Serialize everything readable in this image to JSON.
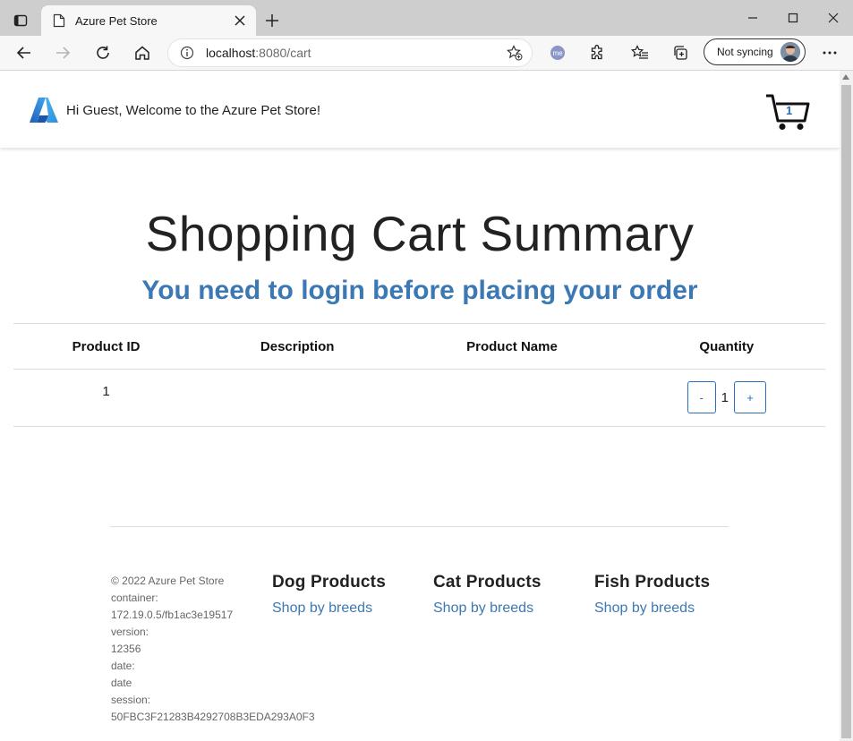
{
  "browser": {
    "tab_title": "Azure Pet Store",
    "url_host": "localhost",
    "url_path": ":8080/cart",
    "profile_label": "Not syncing",
    "extension_label": "me"
  },
  "header": {
    "welcome": "Hi Guest, Welcome to the Azure Pet Store!",
    "cart_count": "1"
  },
  "main": {
    "title": "Shopping Cart Summary",
    "login_message": "You need to login before placing your order",
    "table": {
      "columns": [
        "Product ID",
        "Description",
        "Product Name",
        "Quantity"
      ],
      "rows": [
        {
          "product_id": "1",
          "description": "",
          "product_name": "",
          "quantity": "1",
          "minus": "-",
          "plus": "+"
        }
      ]
    }
  },
  "footer": {
    "copyright": "© 2022 Azure Pet Store",
    "container_label": "container:",
    "container_value": "172.19.0.5/fb1ac3e19517",
    "version_label": "version:",
    "version_value": "12356",
    "date_label": "date:",
    "date_value": "date",
    "session_label": "session:",
    "session_value": "50FBC3F21283B4292708B3EDA293A0F3",
    "columns": [
      {
        "heading": "Dog Products",
        "link": "Shop by breeds"
      },
      {
        "heading": "Cat Products",
        "link": "Shop by breeds"
      },
      {
        "heading": "Fish Products",
        "link": "Shop by breeds"
      }
    ]
  },
  "colors": {
    "accent": "#3c78b4",
    "button_border": "#2a6ebb",
    "tabbar_bg": "#cecece",
    "toolbar_bg": "#f7f7f7"
  },
  "icons": [
    "tab-actions-icon",
    "page-favicon-icon",
    "close-icon",
    "new-tab-icon",
    "minimize-icon",
    "maximize-icon",
    "window-close-icon",
    "back-icon",
    "forward-icon",
    "refresh-icon",
    "home-icon",
    "site-info-icon",
    "favorite-add-icon",
    "extension-me-icon",
    "extensions-icon",
    "favorites-icon",
    "collections-icon",
    "more-icon",
    "azure-logo-icon",
    "cart-icon"
  ]
}
